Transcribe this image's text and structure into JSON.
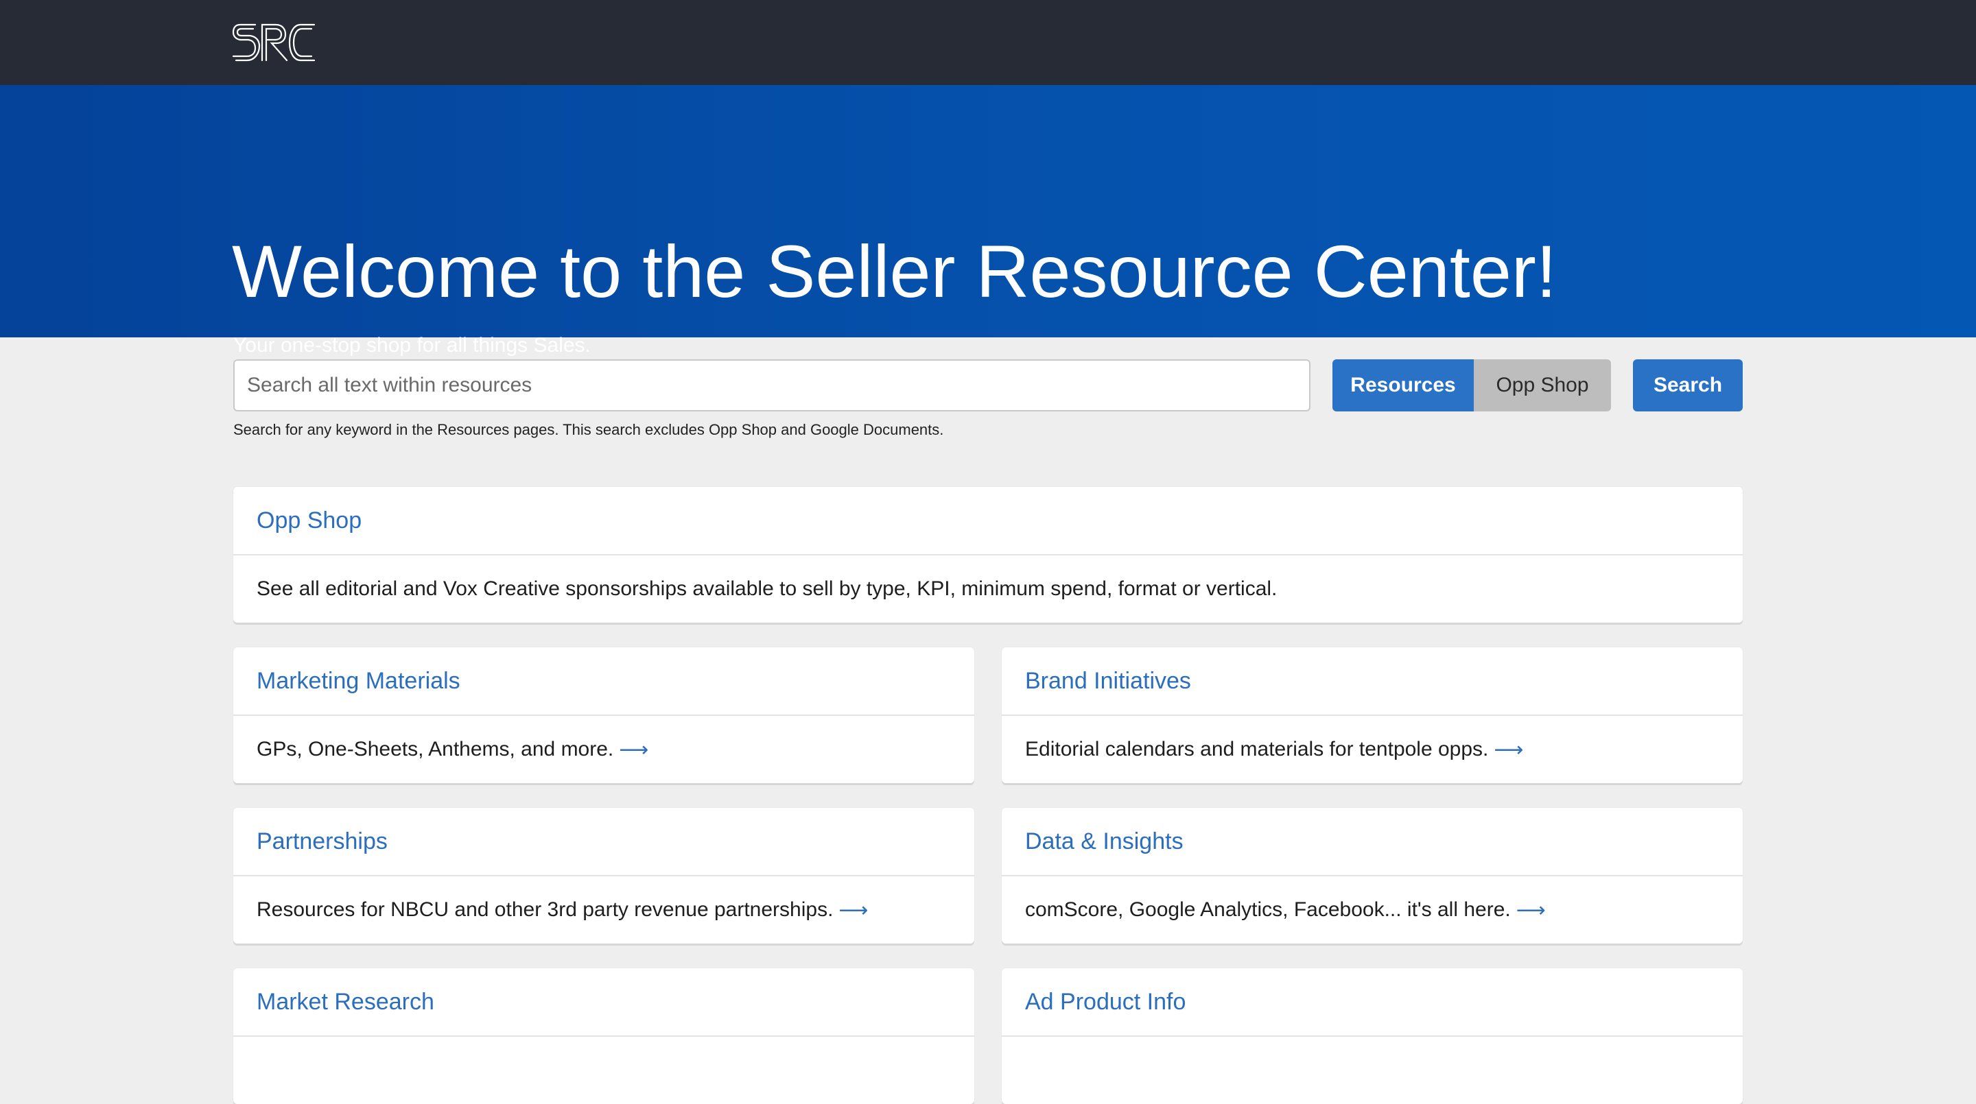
{
  "header": {
    "logo_text": "SRC"
  },
  "hero": {
    "title": "Welcome to the Seller Resource Center!",
    "subtitle": "Your one-stop shop for all things Sales."
  },
  "search": {
    "placeholder": "Search all text within resources",
    "value": "",
    "toggle_resources": "Resources",
    "toggle_opp_shop": "Opp Shop",
    "search_button": "Search",
    "hint": "Search for any keyword in the Resources pages. This search excludes Opp Shop and Google Documents."
  },
  "cards": [
    {
      "title": "Opp Shop",
      "description": "See all editorial and Vox Creative sponsorships available to sell by type, KPI, minimum spend, format or vertical.",
      "arrow": ""
    },
    {
      "title": "Marketing Materials",
      "description": "GPs, One-Sheets, Anthems, and more.",
      "arrow": "⟶"
    },
    {
      "title": "Brand Initiatives",
      "description": "Editorial calendars and materials for tentpole opps.",
      "arrow": "⟶"
    },
    {
      "title": "Partnerships",
      "description": "Resources for NBCU and other 3rd party revenue partnerships.",
      "arrow": "⟶"
    },
    {
      "title": "Data & Insights",
      "description": "comScore, Google Analytics, Facebook... it's all here.",
      "arrow": "⟶"
    },
    {
      "title": "Market Research",
      "description": "",
      "arrow": ""
    },
    {
      "title": "Ad Product Info",
      "description": "",
      "arrow": ""
    }
  ],
  "colors": {
    "topbar": "#272b35",
    "hero": "#0552ad",
    "accent": "#2a72c6",
    "link": "#2a6ebd",
    "toggle_inactive": "#bdbdbd",
    "page_background": "#eeeeee"
  }
}
